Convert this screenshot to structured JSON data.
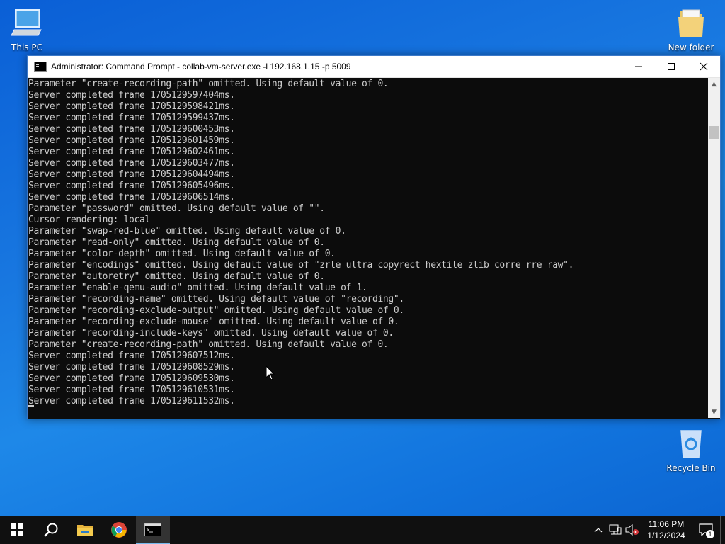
{
  "desktop": {
    "icons": [
      {
        "label": "This PC"
      },
      {
        "label": "New folder"
      },
      {
        "label": "Recycle Bin"
      }
    ]
  },
  "window": {
    "title": "Administrator: Command Prompt - collab-vm-server.exe  -l 192.168.1.15 -p 5009",
    "controls": {
      "minimize": "minimize",
      "maximize": "maximize",
      "close": "close"
    }
  },
  "console": {
    "lines": [
      "Parameter \"create-recording-path\" omitted. Using default value of 0.",
      "Server completed frame 1705129597404ms.",
      "Server completed frame 1705129598421ms.",
      "Server completed frame 1705129599437ms.",
      "Server completed frame 1705129600453ms.",
      "Server completed frame 1705129601459ms.",
      "Server completed frame 1705129602461ms.",
      "Server completed frame 1705129603477ms.",
      "Server completed frame 1705129604494ms.",
      "Server completed frame 1705129605496ms.",
      "Server completed frame 1705129606514ms.",
      "Parameter \"password\" omitted. Using default value of \"\".",
      "Cursor rendering: local",
      "Parameter \"swap-red-blue\" omitted. Using default value of 0.",
      "Parameter \"read-only\" omitted. Using default value of 0.",
      "Parameter \"color-depth\" omitted. Using default value of 0.",
      "Parameter \"encodings\" omitted. Using default value of \"zrle ultra copyrect hextile zlib corre rre raw\".",
      "Parameter \"autoretry\" omitted. Using default value of 0.",
      "Parameter \"enable-qemu-audio\" omitted. Using default value of 1.",
      "Parameter \"recording-name\" omitted. Using default value of \"recording\".",
      "Parameter \"recording-exclude-output\" omitted. Using default value of 0.",
      "Parameter \"recording-exclude-mouse\" omitted. Using default value of 0.",
      "Parameter \"recording-include-keys\" omitted. Using default value of 0.",
      "Parameter \"create-recording-path\" omitted. Using default value of 0.",
      "Server completed frame 1705129607512ms.",
      "Server completed frame 1705129608529ms.",
      "Server completed frame 1705129609530ms.",
      "Server completed frame 1705129610531ms.",
      "Server completed frame 1705129611532ms."
    ],
    "text_color": "#cccccc",
    "background": "#0c0c0c"
  },
  "taskbar": {
    "buttons": [
      {
        "icon": "windows-start-icon"
      },
      {
        "icon": "search-icon"
      },
      {
        "icon": "file-explorer-icon"
      },
      {
        "icon": "chrome-icon"
      },
      {
        "icon": "command-prompt-icon"
      }
    ],
    "clock": {
      "time": "11:06 PM",
      "date": "1/12/2024"
    },
    "notification_count": "1",
    "accent": "#76b9ed"
  }
}
